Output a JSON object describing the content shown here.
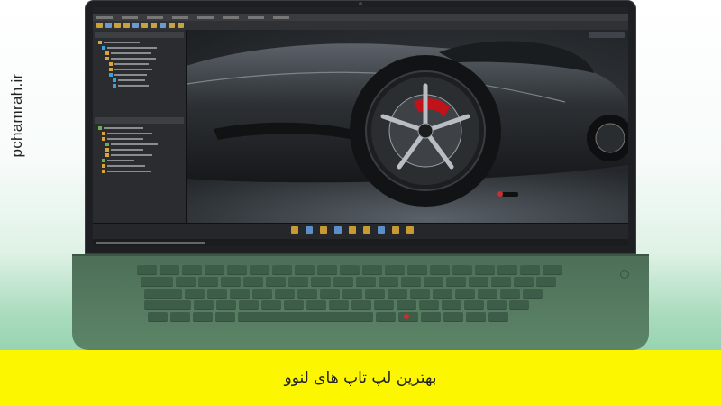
{
  "watermark": {
    "text": "pchamrah.ir"
  },
  "caption": {
    "text": "بهترین لپ تاپ های لنوو"
  },
  "colors": {
    "caption_background": "#fcf700",
    "laptop_deck": "#5c8567",
    "trackpoint": "#c53030"
  },
  "screen": {
    "app": "3D modeling software",
    "subject": "dark sports car"
  }
}
